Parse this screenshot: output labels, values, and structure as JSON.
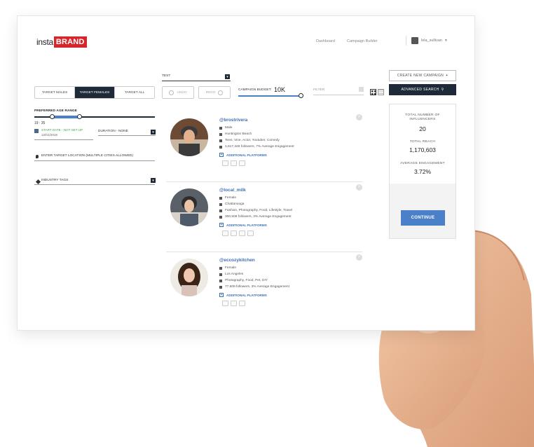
{
  "header": {
    "logo_left": "insta",
    "logo_right": "BRAND",
    "nav": [
      "Dashboard",
      "Campaign Builder"
    ],
    "user_name": "lela_sullivan",
    "user_caret": "▾"
  },
  "targeting": {
    "tabs": [
      "TARGET MALES",
      "TARGET FEMALES",
      "TARGET ALL"
    ],
    "age_label": "PREFERRED AGE RANGE",
    "age_min": "19",
    "age_sep": ":",
    "age_max": "35",
    "start_date_label": "START DATE  -  NOT SET UP",
    "start_date_value": "12/01/2019",
    "duration": "DURATION  -  NONE",
    "location_placeholder": "ENTER TARGET LOCATION (MULTIPLE CITIES ALLOWED)",
    "industry": "INDUSTRY TAGS"
  },
  "controls": {
    "test_label": "TEST",
    "undo": "UNDO",
    "redo": "REDO",
    "budget_label": "CAMPAIGN BUDGET:",
    "budget_value": "10K",
    "budget_level": 1.0,
    "filter": "FILTER"
  },
  "influencers": [
    {
      "handle": "@brostrivera",
      "gender": "Male",
      "location": "Huntington Beach",
      "tags": "Teen, Vine, Actor, Youtuber, Comedy",
      "followers": "1,617,348 followers, 7% Average Engagement",
      "additional": "ADDITIONAL PLATFORMS"
    },
    {
      "handle": "@local_milk",
      "gender": "Female",
      "location": "Chattanooga",
      "tags": "Fashion, Photography, Food, Lifestyle, Travel",
      "followers": "300,508 followers, 3% Average Engagement",
      "additional": "ADDITIONAL PLATFORMS"
    },
    {
      "handle": "@eccozykitchen",
      "gender": "Female",
      "location": "Los Angeles",
      "tags": "Photography, Food, Pet, DIY",
      "followers": "77,609 followers, 3% Average Engagement",
      "additional": "ADDITIONAL PLATFORMS"
    }
  ],
  "sidebar": {
    "create_label": "CREATE NEW CAMPAIGN",
    "create_icon": "+",
    "advanced_label": "ADVANCED SEARCH",
    "total_label": "TOTAL NUMBER OF INFLUENCERS",
    "total_value": "20",
    "reach_label": "TOTAL REACH",
    "reach_value": "1,170,603",
    "engagement_label": "AVERAGE ENGAGEMENT",
    "engagement_value": "3.72%",
    "continue_label": "CONTINUE"
  },
  "colors": {
    "brand_red": "#d6252b",
    "navy": "#1e2a38",
    "accent_blue": "#4a80c8",
    "link_blue": "#3b6fb5",
    "skin": "#e8b48f"
  }
}
